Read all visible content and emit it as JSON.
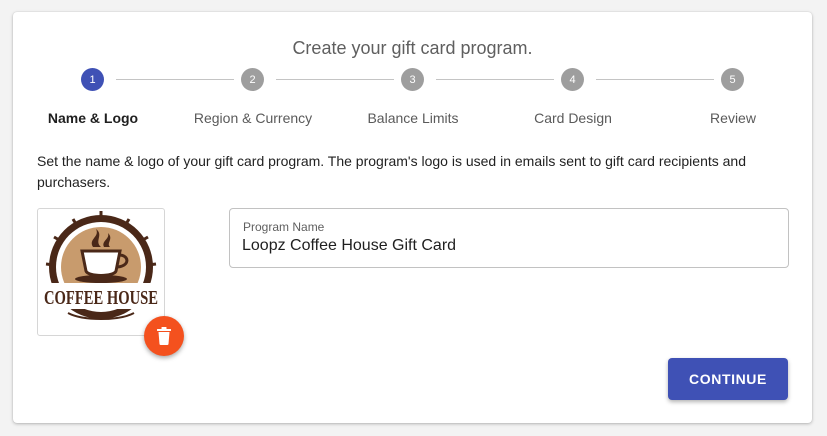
{
  "wizard": {
    "title": "Create your gift card program.",
    "active_step": 1,
    "steps": [
      {
        "number": "1",
        "label": "Name & Logo"
      },
      {
        "number": "2",
        "label": "Region & Currency"
      },
      {
        "number": "3",
        "label": "Balance Limits"
      },
      {
        "number": "4",
        "label": "Card Design"
      },
      {
        "number": "5",
        "label": "Review"
      }
    ]
  },
  "form": {
    "description": "Set the name & logo of your gift card program. The program's logo is used in emails sent to gift card recipients and purchasers.",
    "logo": {
      "text": "COFFEE HOUSE",
      "icon": "coffee-cup-logo"
    },
    "delete_logo_icon": "trash-icon",
    "program_name": {
      "label": "Program Name",
      "value": "Loopz Coffee House Gift Card"
    }
  },
  "actions": {
    "continue_label": "CONTINUE"
  },
  "colors": {
    "primary": "#3f51b5",
    "delete": "#f4511e",
    "inactive_step": "#9e9e9e"
  }
}
